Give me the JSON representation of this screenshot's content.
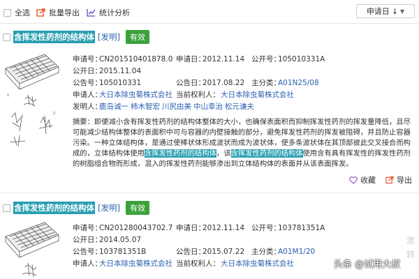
{
  "toolbar": {
    "select_all": "全选",
    "batch_export": "批量导出",
    "stats": "统计分析",
    "sort": "申请日",
    "sort_arrow": "↓",
    "sort_caret": "▼"
  },
  "records": [
    {
      "title": "含挥发性药剂的结构体",
      "type_tag": "[发明]",
      "status": "有效",
      "app_no_label": "申请号：",
      "app_no": "CN201510401878.0",
      "app_date_label": "申请日：",
      "app_date": "2012.11.14",
      "pub_no_label": "公开号：",
      "pub_no": "105010331A",
      "pub_date_label": "公开日：",
      "pub_date": "2015.11.04",
      "grant_no_label": "公告号：",
      "grant_no": "105010331",
      "grant_date_label": "公告日：",
      "grant_date": "2017.08.22",
      "ipc_label": "主分类：",
      "ipc": "A01N25/08",
      "applicant_label": "申请人：",
      "applicant": "大日本除虫菊株式会社",
      "holder_label": "当前权利人：",
      "holder": "大日本除虫菊株式会社",
      "inventor_label": "发明人：",
      "inventors": [
        "鹿岛诚一",
        "柿木智宏",
        "川尻由美",
        "中山幸治",
        "松元谦夫"
      ],
      "abstract_label": "摘要：",
      "abstract_1": "即便减小含有挥发性药剂的结构体整体的大小，也确保表面积而抑制挥发性药剂的挥发量降低，且尽可能减少结构体整体的表面积中可与容器的内壁接触的部分，避免挥发性药剂的挥发被阻碍，并且防止容器污染。一种立体结构体，是通过使棒状体形成波状而成为波状体，使多条波状体在其顶部彼此交叉接合而构成的，立体结构体使用",
      "abstract_hl_1": "含挥发性药剂的结构体",
      "abstract_2": "，该",
      "abstract_hl_2": "含挥发性药剂的结构体",
      "abstract_3": "使用含有具有挥发性的挥发性药剂的树脂组合物而形成，混入的挥发性药剂能够渗出到立体结构体的表面并从该表面挥发。",
      "favorite": "收藏",
      "export": "导出"
    },
    {
      "title": "含挥发性药剂的结构体",
      "type_tag": "[发明]",
      "status": "有效",
      "app_no_label": "申请号：",
      "app_no": "CN201280043702.7",
      "app_date_label": "申请日：",
      "app_date": "2012.11.14",
      "pub_no_label": "公开号：",
      "pub_no": "103781351A",
      "pub_date_label": "公开日：",
      "pub_date": "2014.05.07",
      "grant_no_label": "公告号：",
      "grant_no": "103781351B",
      "grant_date_label": "公告日：",
      "grant_date": "2015.07.22",
      "ipc_label": "主分类：",
      "ipc": "A01M1/20",
      "applicant_label": "申请人：",
      "applicant": "大日本除虫菊株式会社",
      "holder_label": "当前权利人：",
      "holder": "大日本除虫菊株式会社"
    }
  ],
  "side_ghost": [
    "激",
    "转"
  ],
  "watermark": "头条 @试用大叔"
}
